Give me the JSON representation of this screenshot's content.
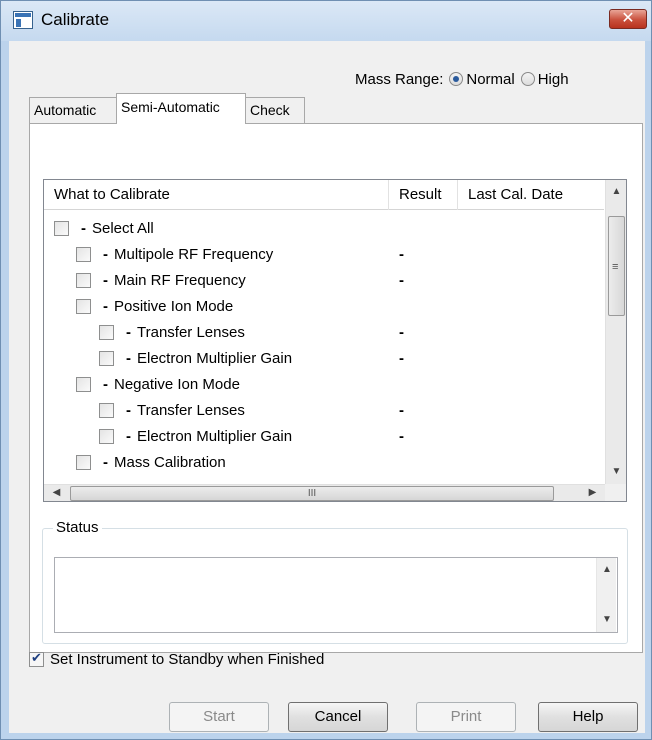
{
  "window": {
    "title": "Calibrate",
    "close_label": "✕"
  },
  "mass_range": {
    "label": "Mass Range:",
    "options": [
      "Normal",
      "High"
    ],
    "selected": "Normal"
  },
  "tabs": [
    {
      "label": "Automatic",
      "active": false
    },
    {
      "label": "Semi-Automatic",
      "active": true
    },
    {
      "label": "Check",
      "active": false
    }
  ],
  "tree": {
    "columns": [
      "What to Calibrate",
      "Result",
      "Last Cal. Date"
    ],
    "rows": [
      {
        "label": "Select All",
        "level": 0,
        "result": ""
      },
      {
        "label": "Multipole RF Frequency",
        "level": 1,
        "result": "-"
      },
      {
        "label": "Main RF Frequency",
        "level": 1,
        "result": "-"
      },
      {
        "label": "Positive Ion Mode",
        "level": 1,
        "result": ""
      },
      {
        "label": "Transfer Lenses",
        "level": 2,
        "result": "-"
      },
      {
        "label": "Electron Multiplier Gain",
        "level": 2,
        "result": "-"
      },
      {
        "label": "Negative Ion Mode",
        "level": 1,
        "result": ""
      },
      {
        "label": "Transfer Lenses",
        "level": 2,
        "result": "-"
      },
      {
        "label": "Electron Multiplier Gain",
        "level": 2,
        "result": "-"
      },
      {
        "label": "Mass Calibration",
        "level": 1,
        "result": ""
      }
    ]
  },
  "status": {
    "label": "Status",
    "text": ""
  },
  "standby": {
    "label": "Set Instrument to Standby when Finished",
    "checked": true
  },
  "buttons": {
    "start": "Start",
    "cancel": "Cancel",
    "print": "Print",
    "help": "Help"
  }
}
